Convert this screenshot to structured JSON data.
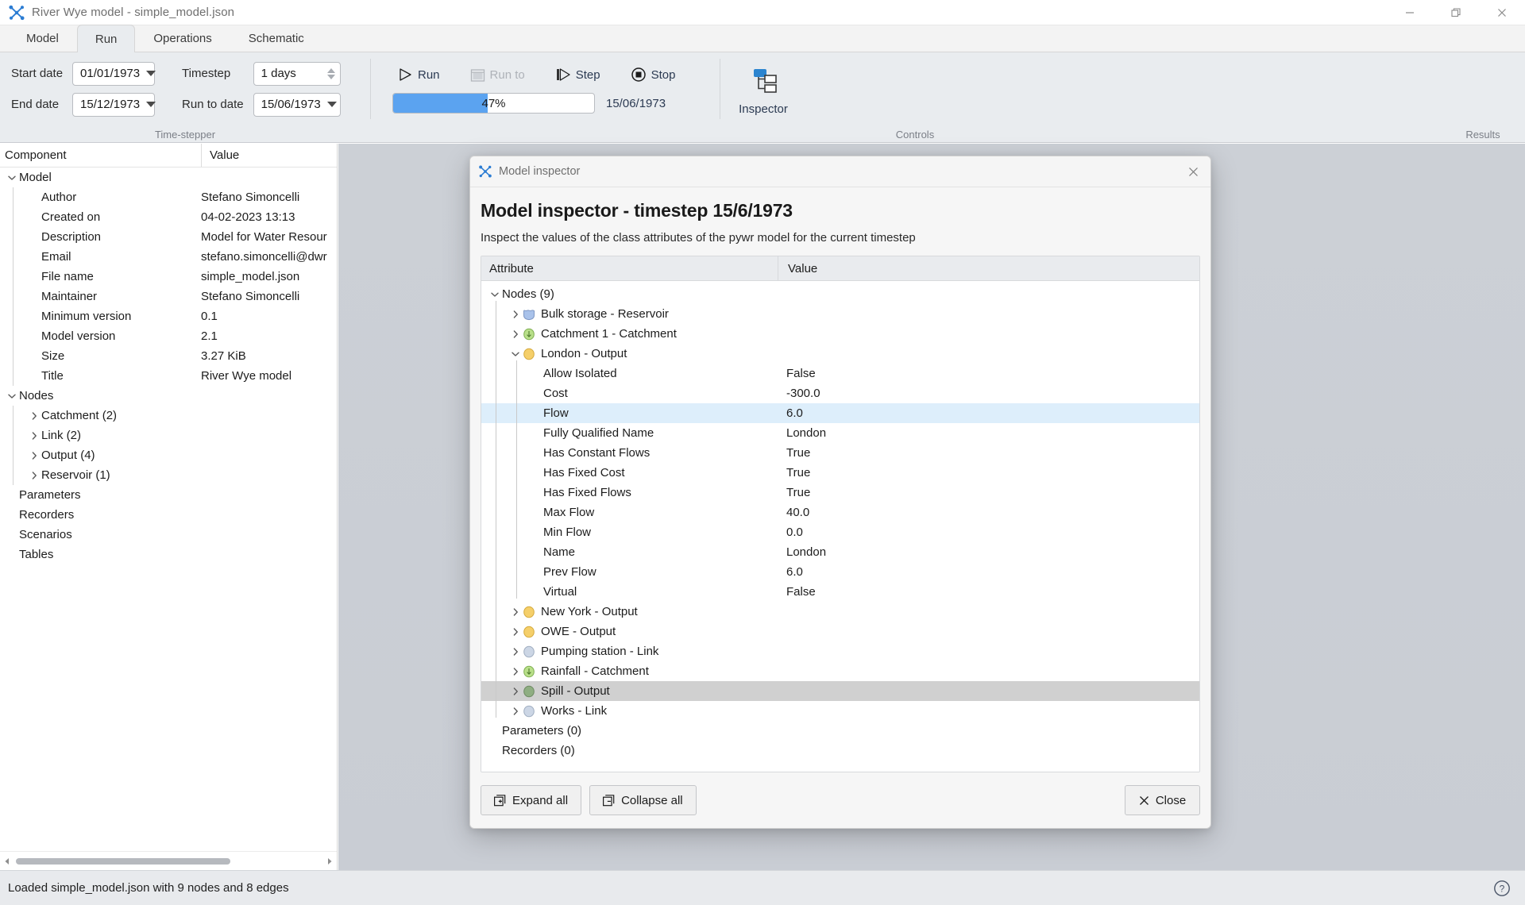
{
  "window": {
    "title": "River Wye model - simple_model.json",
    "app_icon": "pywr-icon",
    "minimize_label": "Minimize",
    "maximize_label": "Restore",
    "close_label": "Close"
  },
  "ribbon": {
    "tabs": [
      {
        "label": "Model",
        "active": false
      },
      {
        "label": "Run",
        "active": true
      },
      {
        "label": "Operations",
        "active": false
      },
      {
        "label": "Schematic",
        "active": false
      }
    ],
    "groups": [
      {
        "label": "Time-stepper"
      },
      {
        "label": "Controls"
      },
      {
        "label": "Results"
      }
    ],
    "timestepper": {
      "start_date_label": "Start date",
      "start_date_value": "01/01/1973",
      "end_date_label": "End date",
      "end_date_value": "15/12/1973",
      "timestep_label": "Timestep",
      "timestep_value": "1 days",
      "run_to_date_label": "Run to date",
      "run_to_date_value": "15/06/1973"
    },
    "controls": {
      "run_label": "Run",
      "run_to_label": "Run to",
      "step_label": "Step",
      "stop_label": "Stop",
      "progress_percent": "47%",
      "progress_value": 47,
      "progress_date": "15/06/1973"
    },
    "results": {
      "inspector_label": "Inspector"
    }
  },
  "left_tree": {
    "header": {
      "component": "Component",
      "value": "Value"
    },
    "rows": [
      {
        "label": "Model",
        "value": "",
        "indent": 0,
        "chevron": "down"
      },
      {
        "label": "Author",
        "value": "Stefano Simoncelli",
        "indent": 1,
        "chevron": "none"
      },
      {
        "label": "Created on",
        "value": "04-02-2023 13:13",
        "indent": 1,
        "chevron": "none"
      },
      {
        "label": "Description",
        "value": "Model for Water Resour",
        "indent": 1,
        "chevron": "none"
      },
      {
        "label": "Email",
        "value": "stefano.simoncelli@dwr",
        "indent": 1,
        "chevron": "none"
      },
      {
        "label": "File name",
        "value": "simple_model.json",
        "indent": 1,
        "chevron": "none"
      },
      {
        "label": "Maintainer",
        "value": "Stefano Simoncelli",
        "indent": 1,
        "chevron": "none"
      },
      {
        "label": "Minimum version",
        "value": "0.1",
        "indent": 1,
        "chevron": "none"
      },
      {
        "label": "Model version",
        "value": "2.1",
        "indent": 1,
        "chevron": "none"
      },
      {
        "label": "Size",
        "value": "3.27 KiB",
        "indent": 1,
        "chevron": "none"
      },
      {
        "label": "Title",
        "value": "River Wye model",
        "indent": 1,
        "chevron": "none"
      },
      {
        "label": "Nodes",
        "value": "",
        "indent": 0,
        "chevron": "down"
      },
      {
        "label": "Catchment (2)",
        "value": "",
        "indent": 1,
        "chevron": "right"
      },
      {
        "label": "Link (2)",
        "value": "",
        "indent": 1,
        "chevron": "right"
      },
      {
        "label": "Output (4)",
        "value": "",
        "indent": 1,
        "chevron": "right"
      },
      {
        "label": "Reservoir (1)",
        "value": "",
        "indent": 1,
        "chevron": "right"
      },
      {
        "label": "Parameters",
        "value": "",
        "indent": 0,
        "chevron": "none"
      },
      {
        "label": "Recorders",
        "value": "",
        "indent": 0,
        "chevron": "none"
      },
      {
        "label": "Scenarios",
        "value": "",
        "indent": 0,
        "chevron": "none"
      },
      {
        "label": "Tables",
        "value": "",
        "indent": 0,
        "chevron": "none"
      }
    ]
  },
  "dialog": {
    "titlebar_text": "Model inspector",
    "heading": "Model inspector - timestep 15/6/1973",
    "subheading": "Inspect the values of the class attributes of the pywr model for the current timestep",
    "table_header": {
      "attribute": "Attribute",
      "value": "Value"
    },
    "rows": [
      {
        "label": "Nodes (9)",
        "value": "",
        "indent": 0,
        "chevron": "down",
        "icon": "none",
        "select": "none"
      },
      {
        "label": "Bulk storage - Reservoir",
        "value": "",
        "indent": 1,
        "chevron": "right",
        "icon": "reservoir",
        "select": "none"
      },
      {
        "label": "Catchment 1 - Catchment",
        "value": "",
        "indent": 1,
        "chevron": "right",
        "icon": "catchment",
        "select": "none"
      },
      {
        "label": "London - Output",
        "value": "",
        "indent": 1,
        "chevron": "down",
        "icon": "output",
        "select": "none"
      },
      {
        "label": "Allow Isolated",
        "value": "False",
        "indent": 2,
        "chevron": "none",
        "icon": "none",
        "select": "none"
      },
      {
        "label": "Cost",
        "value": "-300.0",
        "indent": 2,
        "chevron": "none",
        "icon": "none",
        "select": "none"
      },
      {
        "label": "Flow",
        "value": "6.0",
        "indent": 2,
        "chevron": "none",
        "icon": "none",
        "select": "blue"
      },
      {
        "label": "Fully Qualified Name",
        "value": "London",
        "indent": 2,
        "chevron": "none",
        "icon": "none",
        "select": "none"
      },
      {
        "label": "Has Constant Flows",
        "value": "True",
        "indent": 2,
        "chevron": "none",
        "icon": "none",
        "select": "none"
      },
      {
        "label": "Has Fixed Cost",
        "value": "True",
        "indent": 2,
        "chevron": "none",
        "icon": "none",
        "select": "none"
      },
      {
        "label": "Has Fixed Flows",
        "value": "True",
        "indent": 2,
        "chevron": "none",
        "icon": "none",
        "select": "none"
      },
      {
        "label": "Max Flow",
        "value": "40.0",
        "indent": 2,
        "chevron": "none",
        "icon": "none",
        "select": "none"
      },
      {
        "label": "Min Flow",
        "value": "0.0",
        "indent": 2,
        "chevron": "none",
        "icon": "none",
        "select": "none"
      },
      {
        "label": "Name",
        "value": "London",
        "indent": 2,
        "chevron": "none",
        "icon": "none",
        "select": "none"
      },
      {
        "label": "Prev Flow",
        "value": "6.0",
        "indent": 2,
        "chevron": "none",
        "icon": "none",
        "select": "none"
      },
      {
        "label": "Virtual",
        "value": "False",
        "indent": 2,
        "chevron": "none",
        "icon": "none",
        "select": "none"
      },
      {
        "label": "New York - Output",
        "value": "",
        "indent": 1,
        "chevron": "right",
        "icon": "output",
        "select": "none"
      },
      {
        "label": "OWE - Output",
        "value": "",
        "indent": 1,
        "chevron": "right",
        "icon": "output",
        "select": "none"
      },
      {
        "label": "Pumping station - Link",
        "value": "",
        "indent": 1,
        "chevron": "right",
        "icon": "link",
        "select": "none"
      },
      {
        "label": "Rainfall - Catchment",
        "value": "",
        "indent": 1,
        "chevron": "right",
        "icon": "catchment",
        "select": "none"
      },
      {
        "label": "Spill - Output",
        "value": "",
        "indent": 1,
        "chevron": "right",
        "icon": "spill",
        "select": "grey"
      },
      {
        "label": "Works - Link",
        "value": "",
        "indent": 1,
        "chevron": "right",
        "icon": "link",
        "select": "none"
      },
      {
        "label": "Parameters (0)",
        "value": "",
        "indent": 0,
        "chevron": "none",
        "icon": "none",
        "select": "none"
      },
      {
        "label": "Recorders (0)",
        "value": "",
        "indent": 0,
        "chevron": "none",
        "icon": "none",
        "select": "none"
      }
    ],
    "buttons": {
      "expand_all": "Expand all",
      "collapse_all": "Collapse all",
      "close": "Close"
    }
  },
  "statusbar": {
    "message": "Loaded simple_model.json with 9 nodes and 8 edges",
    "help_icon": "help-icon"
  },
  "colors": {
    "accent": "#5ba3f0",
    "selection_blue": "#ddeefb",
    "selection_grey": "#d0d0d0",
    "node_output": "#f5cf6a",
    "node_catchment": "#b9e08a",
    "node_link": "#ccd6e5",
    "node_reservoir": "#a9c2ea",
    "node_spill": "#8fae82"
  }
}
